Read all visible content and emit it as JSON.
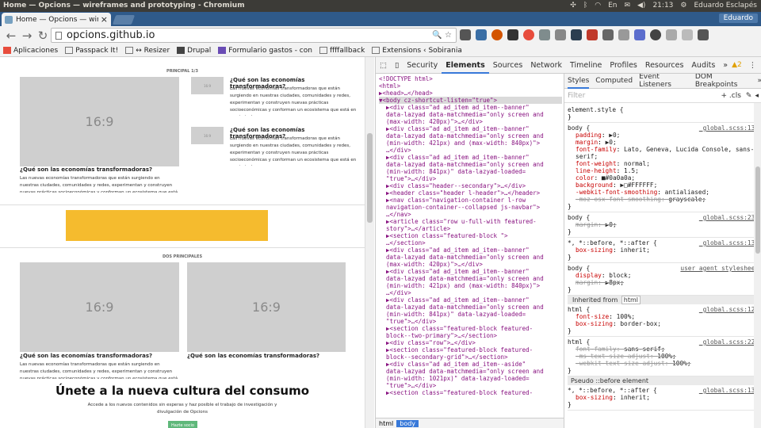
{
  "system": {
    "window_title": "Home — Opcions — wireframes and prototyping - Chromium",
    "time": "21:13",
    "user": "Eduardo Esclapés",
    "lang": "En"
  },
  "browser": {
    "tab_title": "Home — Opcions — wirefr",
    "profile": "Eduardo",
    "url": "opcions.github.io",
    "bookmarks": [
      "Aplicaciones",
      "Passpack It!",
      "↔ Resizer",
      "Drupal",
      "Formulario gastos - con",
      "ffffallback",
      "Extensions ‹ Sobirania"
    ]
  },
  "page": {
    "section1": "PRINCIPAL 1/3",
    "placeholder": "16:9",
    "question": "¿Qué son las economías transformadoras?",
    "desc_right": "Las nuevas economías transformadoras que están surgiendo en nuestras ciudades, comunidades y redes, experimentan y construyen nuevas prácticas socioeconómicas y conforman un ecosistema que está en crecimiento",
    "desc_left": "Las nuevas economías transformadoras que están surgiendo en nuestras ciudades, comunidades y redes, experimentan y construyen nuevas prácticas socioeconómicas y conforman un ecosistema que está en crecimiento",
    "section2": "DOS PRINCIPALES",
    "cta_title": "Únete a la nueva cultura del consumo",
    "cta_text": "Accede a los nuevos contenidos sin esperas y haz posible el trabajo de investigación y divulgación de Opcions",
    "cta_button": "Hazte socio",
    "banner_color": "#f5bb2e"
  },
  "devtools": {
    "tabs": [
      "Security",
      "Elements",
      "Sources",
      "Network",
      "Timeline",
      "Profiles",
      "Resources",
      "Audits",
      "»"
    ],
    "active_tab": "Elements",
    "warnings": "▲2",
    "html_lines": [
      "<!DOCTYPE html>",
      "<html>",
      "▶<head>…</head>",
      "▼<body cz-shortcut-listen=\"true\">",
      "  ▶<div class=\"ad ad_item ad_item--banner\"",
      "  data-lazyad data-matchmedia=\"only screen and",
      "  (max-width: 420px)\">…</div>",
      "  ▶<div class=\"ad ad_item ad_item--banner\"",
      "  data-lazyad data-matchmedia=\"only screen and",
      "  (min-width: 421px) and (max-width: 840px)\">",
      "  …</div>",
      "  ▶<div class=\"ad ad_item ad_item--banner\"",
      "  data-lazyad data-matchmedia=\"only screen and",
      "  (min-width: 841px)\" data-lazyad-loaded=",
      "  \"true\">…</div>",
      "  ▶<div class=\"header--secondary\">…</div>",
      "  ▶<header class=\"header l-header\">…</header>",
      "  ▶<nav class=\"navigation-container l-row",
      "  navigation-container--collapsed js-navbar\">",
      "  …</nav>",
      "  ▶<article class=\"row u-full-with featured-",
      "  story\">…</article>",
      "  ▶<section class=\"featured-block \">",
      "  …</section>",
      "  ▶<div class=\"ad ad_item ad_item--banner\"",
      "  data-lazyad data-matchmedia=\"only screen and",
      "  (max-width: 420px)\">…</div>",
      "  ▶<div class=\"ad ad_item ad_item--banner\"",
      "  data-lazyad data-matchmedia=\"only screen and",
      "  (min-width: 421px) and (max-width: 840px)\">",
      "  …</div>",
      "  ▶<div class=\"ad ad_item ad_item--banner\"",
      "  data-lazyad data-matchmedia=\"only screen and",
      "  (min-width: 841px)\" data-lazyad-loaded=",
      "  \"true\">…</div>",
      "  ▶<section class=\"featured-block featured-",
      "  block--two-primary\">…</section>",
      "  ▶<div class=\"row\">…</div>",
      "  ▶<section class=\"featured-block featured-",
      "  block--secondary-grid\">…</section>",
      "  ▶<div class=\"ad ad_item ad_item--aside\"",
      "  data-lazyad data-matchmedia=\"only screen and",
      "  (min-width: 1021px)\" data-lazyad-loaded=",
      "  \"true\">…</div>",
      "  ▶<section class=\"featured-block featured-"
    ],
    "breadcrumbs": [
      "html",
      "body"
    ],
    "styles_tabs": [
      "Styles",
      "Computed",
      "Event Listeners",
      "DOM Breakpoints",
      "»"
    ],
    "filter_placeholder": "Filter",
    "filter_cls": "+ .cls",
    "rules": [
      {
        "selector": "element.style {",
        "source": "",
        "props": []
      },
      {
        "selector": "body {",
        "source": "_global.scss:137",
        "props": [
          {
            "n": "padding",
            "v": "▶0;",
            "s": false
          },
          {
            "n": "margin",
            "v": "▶0;",
            "s": false
          },
          {
            "n": "font-family",
            "v": "Lato, Geneva, Lucida Console, sans-serif;",
            "s": false
          },
          {
            "n": "font-weight",
            "v": "normal;",
            "s": false
          },
          {
            "n": "line-height",
            "v": "1.5;",
            "s": false
          },
          {
            "n": "color",
            "v": "■#0a0a0a;",
            "s": false
          },
          {
            "n": "background",
            "v": "▶□#FFFFFF;",
            "s": false
          },
          {
            "n": "-webkit-font-smoothing",
            "v": "antialiased;",
            "s": false
          },
          {
            "n": "-moz-osx-font-smoothing",
            "v": "grayscale;",
            "s": true
          }
        ]
      },
      {
        "selector": "body {",
        "source": "_global.scss:231",
        "props": [
          {
            "n": "margin",
            "v": "▶0;",
            "s": true
          }
        ]
      },
      {
        "selector": "*, *::before, *::after {",
        "source": "_global.scss:130",
        "props": [
          {
            "n": "box-sizing",
            "v": "inherit;",
            "s": false
          }
        ]
      },
      {
        "selector": "body {",
        "source": "user agent stylesheet",
        "props": [
          {
            "n": "display",
            "v": "block;",
            "s": false
          },
          {
            "n": "margin",
            "v": "▶8px;",
            "s": true
          }
        ]
      }
    ],
    "inherited_label": "Inherited from",
    "inherited_tag": "html",
    "rules2": [
      {
        "selector": "html {",
        "source": "_global.scss:124",
        "props": [
          {
            "n": "font-size",
            "v": "100%;",
            "s": false
          },
          {
            "n": "box-sizing",
            "v": "border-box;",
            "s": false
          }
        ]
      },
      {
        "selector": "html {",
        "source": "_global.scss:221",
        "props": [
          {
            "n": "font-family",
            "v": "sans-serif;",
            "s": true
          },
          {
            "n": "-ms-text-size-adjust",
            "v": "100%;",
            "s": true
          },
          {
            "n": "-webkit-text-size-adjust",
            "v": "100%;",
            "s": true
          }
        ]
      }
    ],
    "pseudo_label": "Pseudo ::before element",
    "rules3": [
      {
        "selector": "*, *::before, *::after {",
        "source": "_global.scss:131",
        "props": [
          {
            "n": "box-sizing",
            "v": "inherit;",
            "s": false
          }
        ]
      }
    ]
  }
}
